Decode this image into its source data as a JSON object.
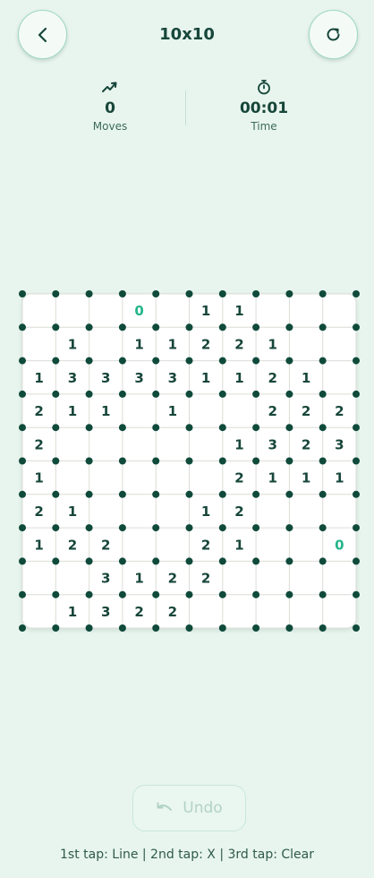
{
  "header": {
    "title": "10x10",
    "back_icon": "chevron-left-icon",
    "reset_icon": "refresh-icon"
  },
  "stats": {
    "moves": {
      "icon": "trending-up-icon",
      "value": "0",
      "label": "Moves"
    },
    "time": {
      "icon": "stopwatch-icon",
      "value": "00:01",
      "label": "Time"
    }
  },
  "board": {
    "size": 10,
    "clues": [
      [
        "",
        "",
        "",
        "0",
        "",
        "1",
        "1",
        "",
        "",
        ""
      ],
      [
        "",
        "1",
        "",
        "1",
        "1",
        "2",
        "2",
        "1",
        "",
        ""
      ],
      [
        "1",
        "3",
        "3",
        "3",
        "3",
        "1",
        "1",
        "2",
        "1",
        ""
      ],
      [
        "2",
        "1",
        "1",
        "",
        "1",
        "",
        "",
        "2",
        "2",
        "2"
      ],
      [
        "2",
        "",
        "",
        "",
        "",
        "",
        "1",
        "3",
        "2",
        "3"
      ],
      [
        "1",
        "",
        "",
        "",
        "",
        "",
        "2",
        "1",
        "1",
        "1"
      ],
      [
        "2",
        "1",
        "",
        "",
        "",
        "1",
        "2",
        "",
        "",
        ""
      ],
      [
        "1",
        "2",
        "2",
        "",
        "",
        "2",
        "1",
        "",
        "",
        "0"
      ],
      [
        "",
        "",
        "3",
        "1",
        "2",
        "2",
        "",
        "",
        "",
        ""
      ],
      [
        "",
        "1",
        "3",
        "2",
        "2",
        "",
        "",
        "",
        "",
        ""
      ]
    ],
    "satisfied_cells": [
      [
        0,
        3
      ],
      [
        7,
        9
      ]
    ],
    "colors": {
      "clue": "#17463a",
      "satisfied": "#25b58a",
      "dot": "#0f4a3a",
      "grid": "#dcdcd6"
    }
  },
  "controls": {
    "undo_label": "Undo",
    "undo_icon": "undo-icon"
  },
  "hint": "1st tap: Line  |  2nd tap: X  |  3rd tap: Clear"
}
